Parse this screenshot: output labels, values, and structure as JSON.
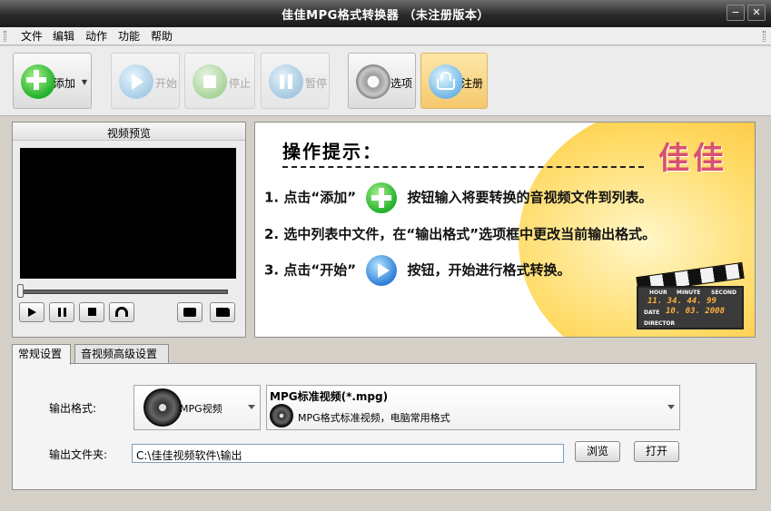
{
  "window": {
    "title": "佳佳MPG格式转换器 （未注册版本）",
    "minimize": "−",
    "close": "✕"
  },
  "menu": [
    "文件",
    "编辑",
    "动作",
    "功能",
    "帮助"
  ],
  "toolbar": {
    "add": "添加",
    "start": "开始",
    "stop": "停止",
    "pause": "暂停",
    "options": "选项",
    "register": "注册"
  },
  "preview": {
    "title": "视频预览",
    "seek_value": 0
  },
  "hint": {
    "title": "操作提示：",
    "logo": "佳佳",
    "line1a": "1. 点击“添加”",
    "line1b": "按钮输入将要转换的音视频文件到列表。",
    "line2": "2. 选中列表中文件，在“输出格式”选项框中更改当前输出格式。",
    "line3a": "3. 点击“开始”",
    "line3b": "按钮，开始进行格式转换。",
    "clap": {
      "hour_label": "HOUR",
      "minute_label": "MINUTE",
      "second_label": "SECOND",
      "time": "11. 34. 44. 99",
      "date_label": "DATE",
      "date": "10. 03. 2008",
      "director_label": "DIRECTOR"
    }
  },
  "tabs": [
    "常规设置",
    "音视频高级设置"
  ],
  "settings": {
    "output_format_label": "输出格式:",
    "format_type": "MPG视频",
    "format_name": "MPG标准视频(*.mpg)",
    "format_desc": "MPG格式标准视频，电脑常用格式",
    "output_folder_label": "输出文件夹:",
    "output_folder": "C:\\佳佳视频软件\\输出",
    "browse": "浏览",
    "open": "打开"
  },
  "colors": {
    "add_icon": "#22b02a",
    "play_icon": "#2f7fd6",
    "register_active": "#f6c86e"
  }
}
